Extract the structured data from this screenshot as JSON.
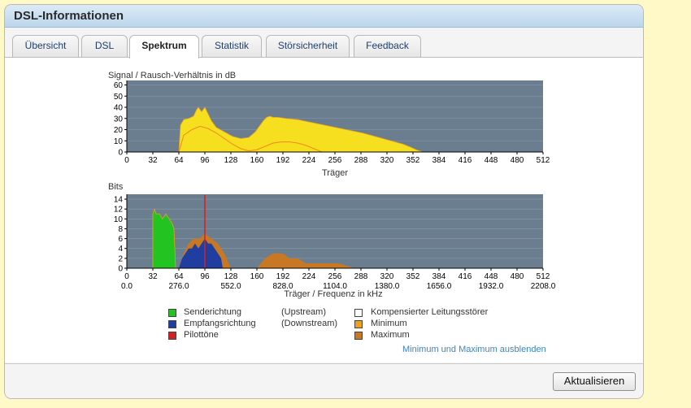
{
  "window": {
    "title": "DSL-Informationen"
  },
  "tabs": [
    {
      "label": "Übersicht"
    },
    {
      "label": "DSL"
    },
    {
      "label": "Spektrum"
    },
    {
      "label": "Statistik"
    },
    {
      "label": "Störsicherheit"
    },
    {
      "label": "Feedback"
    }
  ],
  "active_tab": "Spektrum",
  "snr_chart": {
    "ylabel": "Signal / Rausch-Verhältnis in dB",
    "xlabel": "Träger",
    "yticks": [
      "60",
      "50",
      "40",
      "30",
      "20",
      "10",
      "0"
    ],
    "xticks": [
      "0",
      "32",
      "64",
      "96",
      "128",
      "160",
      "192",
      "224",
      "256",
      "288",
      "320",
      "352",
      "384",
      "416",
      "448",
      "480",
      "512"
    ]
  },
  "bits_chart": {
    "ylabel": "Bits",
    "xlabel": "Träger / Frequenz in kHz",
    "yticks": [
      "14",
      "12",
      "10",
      "8",
      "6",
      "4",
      "2",
      "0"
    ],
    "xticks": [
      "0",
      "32",
      "64",
      "96",
      "128",
      "160",
      "192",
      "224",
      "256",
      "288",
      "320",
      "352",
      "384",
      "416",
      "448",
      "480",
      "512"
    ],
    "freq_ticks": [
      "0.0",
      "276.0",
      "552.0",
      "828.0",
      "1104.0",
      "1380.0",
      "1656.0",
      "1932.0",
      "2208.0"
    ]
  },
  "legend": {
    "upstream": "Senderichtung",
    "upstream_dir": "(Upstream)",
    "downstream": "Empfangsrichtung",
    "downstream_dir": "(Downstream)",
    "pilot": "Pilottöne",
    "compensated": "Kompensierter Leitungsstörer",
    "minimum": "Minimum",
    "maximum": "Maximum"
  },
  "colors": {
    "upstream": "#22c422",
    "downstream": "#1f3ea0",
    "pilot": "#d42020",
    "compensated": "#ffffff",
    "minimum": "#f0a020",
    "maximum": "#c87822",
    "snr_fill": "#f5df1e",
    "plot_bg": "#6b7e90"
  },
  "toggle_link": "Minimum und Maximum ausblenden",
  "footer": {
    "refresh": "Aktualisieren"
  },
  "chart_data": [
    {
      "type": "area",
      "title": "",
      "ylabel": "Signal / Rausch-Verhältnis in dB",
      "xlabel": "Träger",
      "xlim": [
        0,
        512
      ],
      "ylim": [
        0,
        64
      ],
      "series": [
        {
          "name": "",
          "x": [
            64,
            66,
            70,
            76,
            82,
            86,
            88,
            92,
            96,
            100,
            104,
            110,
            120,
            130,
            140,
            150,
            158,
            164,
            168,
            172,
            176,
            180,
            186,
            196,
            210,
            230,
            250,
            270,
            290,
            310,
            330,
            340,
            350,
            356,
            360,
            364
          ],
          "values": [
            0,
            24,
            29,
            30,
            32,
            38,
            40,
            36,
            40,
            34,
            28,
            22,
            18,
            14,
            12,
            13,
            18,
            24,
            28,
            31,
            32,
            31,
            31,
            30,
            29,
            26,
            23,
            20,
            17,
            13,
            9,
            7,
            4,
            2,
            1,
            0
          ]
        },
        {
          "name": "",
          "x": [
            64,
            70,
            80,
            90,
            100,
            110,
            120,
            130,
            140,
            150,
            160,
            170,
            180,
            190,
            200,
            210,
            220,
            230,
            240
          ],
          "values": [
            0,
            15,
            20,
            23,
            21,
            17,
            12,
            7,
            3,
            1,
            2,
            5,
            8,
            9,
            9,
            8,
            6,
            3,
            0
          ]
        }
      ]
    },
    {
      "type": "area",
      "title": "",
      "ylabel": "Bits",
      "xlabel": "Träger / Frequenz in kHz",
      "xlim": [
        0,
        512
      ],
      "ylim": [
        0,
        15
      ],
      "series": [
        {
          "name": "Senderichtung",
          "x": [
            32,
            34,
            36,
            40,
            44,
            48,
            52,
            56,
            58,
            60
          ],
          "values": [
            11,
            12,
            11,
            11,
            10,
            11,
            10,
            9,
            8,
            0
          ]
        },
        {
          "name": "Empfangsrichtung",
          "x": [
            64,
            68,
            72,
            76,
            80,
            84,
            88,
            92,
            96,
            100,
            104,
            108,
            112,
            116,
            118
          ],
          "values": [
            0,
            2,
            3,
            4,
            4,
            5,
            4,
            5,
            6,
            5,
            5,
            4,
            3,
            2,
            0
          ]
        },
        {
          "name": "Maximum",
          "x": [
            64,
            70,
            76,
            82,
            90,
            96,
            104,
            112,
            120,
            128,
            160,
            170,
            180,
            192,
            200,
            210,
            220,
            230,
            240,
            260,
            280
          ],
          "values": [
            0,
            3,
            5,
            6,
            6,
            7,
            6,
            5,
            3,
            0,
            0,
            2,
            3,
            3,
            2,
            2,
            1,
            1,
            1,
            1,
            0
          ]
        },
        {
          "name": "Pilottöne",
          "x": [
            96
          ],
          "values": [
            15
          ]
        }
      ]
    }
  ]
}
